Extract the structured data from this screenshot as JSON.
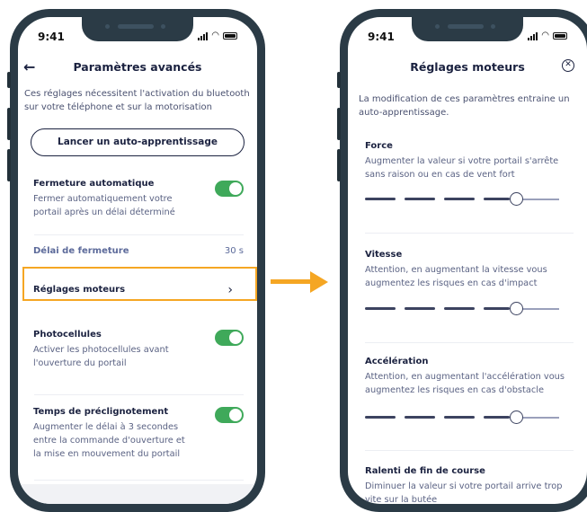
{
  "left_screen": {
    "status": {
      "time": "9:41"
    },
    "header": {
      "title": "Paramètres avancés",
      "back_icon": "arrow-left-icon"
    },
    "intro": "Ces réglages nécessitent l'activation du bluetooth sur votre téléphone et sur la motorisation",
    "cta_label": "Lancer un auto-apprentissage",
    "auto_close": {
      "title": "Fermeture automatique",
      "desc": "Fermer automatiquement votre portail après un délai déterminé",
      "enabled": true
    },
    "delay": {
      "label": "Délai de fermeture",
      "value": "30 s"
    },
    "motor_settings": {
      "label": "Réglages moteurs",
      "chevron_icon": "chevron-right-icon"
    },
    "photocells": {
      "title": "Photocellules",
      "desc": "Activer les photocellules avant l'ouverture du portail",
      "enabled": true
    },
    "preflash": {
      "title": "Temps de préclignotement",
      "desc": "Augmenter le délai à 3 secondes entre la commande d'ouverture et la mise en mouvement du portail",
      "enabled": true
    }
  },
  "right_screen": {
    "status": {
      "time": "9:41"
    },
    "header": {
      "title": "Réglages moteurs",
      "close_icon": "close-circle-icon"
    },
    "intro": "La modification de ces paramètres entraine un auto-apprentissage.",
    "settings": [
      {
        "title": "Force",
        "desc": "Augmenter la valeur si votre portail s'arrête sans raison ou en cas de vent fort",
        "level": 0.78
      },
      {
        "title": "Vitesse",
        "desc": " Attention, en augmentant la vitesse vous augmentez les risques en cas d'impact",
        "level": 0.78
      },
      {
        "title": "Accélération",
        "desc": " Attention, en augmentant l'accélération vous augmentez les risques en cas d'obstacle",
        "level": 0.78
      },
      {
        "title": "Ralenti de fin de course",
        "desc": "Diminuer la valeur si votre portail arrive trop vite sur la butée"
      }
    ]
  },
  "colors": {
    "accent_toggle": "#3fa95a",
    "highlight": "#f5a623",
    "frame": "#2b3b46",
    "text_dark": "#1b2240"
  }
}
